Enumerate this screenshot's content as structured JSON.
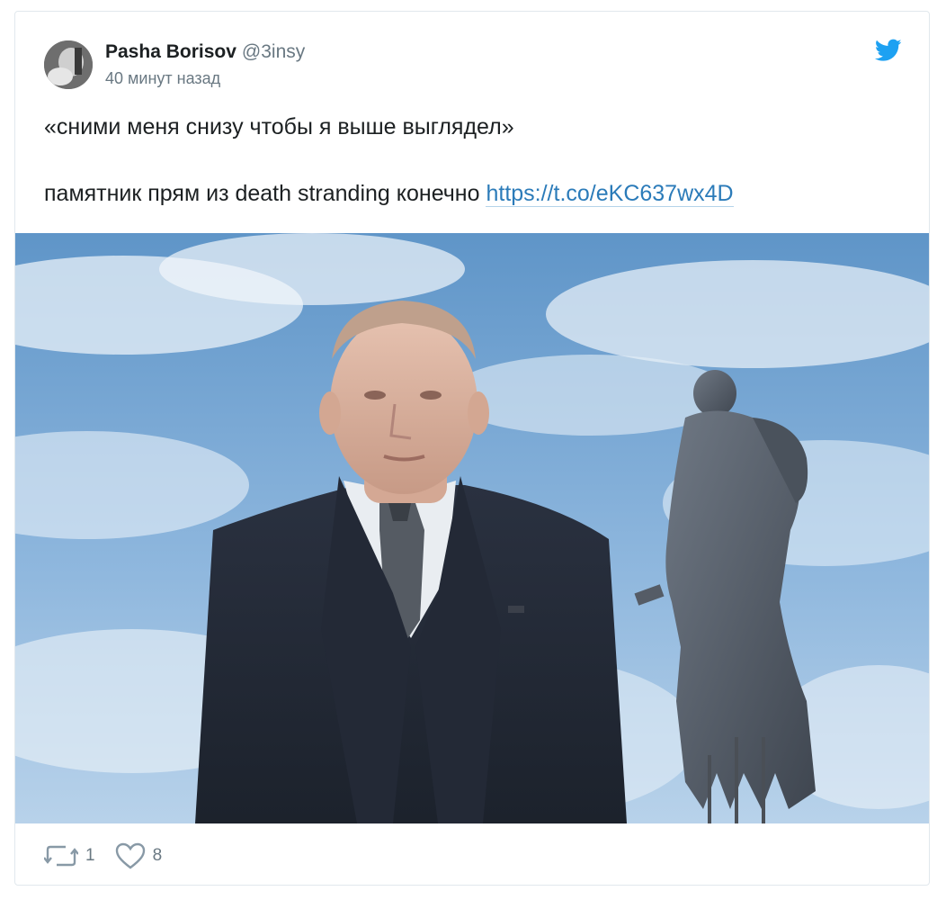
{
  "tweet": {
    "author_name": "Pasha Borisov",
    "author_handle": "@3insy",
    "timestamp": "40 минут назад",
    "text_line1": "«сними меня снизу чтобы я выше выглядел»",
    "text_line2": "памятник прям из death stranding конечно",
    "link_text": "https://t.co/eKC637wx4D",
    "retweet_count": "1",
    "like_count": "8"
  },
  "icons": {
    "brand": "twitter-bird-icon",
    "retweet": "retweet-icon",
    "like": "heart-icon"
  },
  "colors": {
    "link": "#2b7bb9",
    "brand": "#1da1f2",
    "muted": "#697882",
    "text": "#1c2022"
  }
}
